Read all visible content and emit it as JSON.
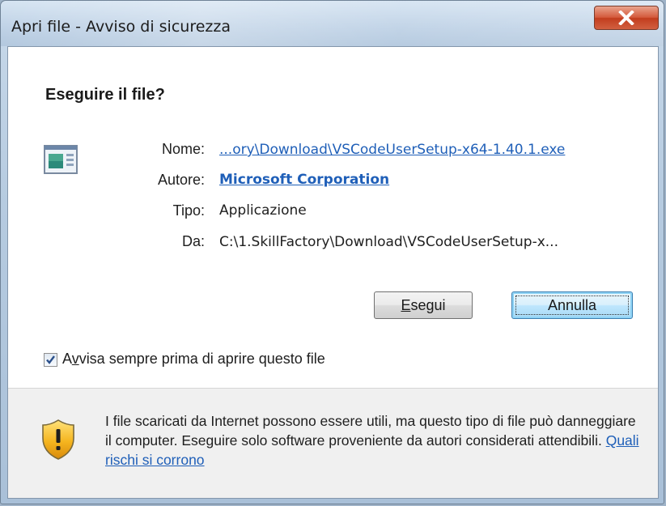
{
  "window": {
    "title": "Apri file - Avviso di sicurezza"
  },
  "dialog": {
    "heading": "Eseguire il file?",
    "fields": [
      {
        "label": "Nome:",
        "value": "...ory\\Download\\VSCodeUserSetup-x64-1.40.1.exe",
        "is_link": true
      },
      {
        "label": "Autore:",
        "value": "Microsoft Corporation",
        "is_link": true
      },
      {
        "label": "Tipo:",
        "value": "Applicazione",
        "is_link": false
      },
      {
        "label": "Da:",
        "value": "C:\\1.SkillFactory\\Download\\VSCodeUserSetup-x...",
        "is_link": false
      }
    ],
    "run_button": {
      "mnemonic": "E",
      "rest": "segui"
    },
    "cancel_button": {
      "label": "Annulla"
    },
    "checkbox": {
      "checked": true,
      "label_pre": "A",
      "label_mnemonic": "v",
      "label_post": "visa sempre prima di aprire questo file"
    }
  },
  "warning": {
    "text": "I file scaricati da Internet possono essere utili, ma questo tipo di file può danneggiare il computer. Eseguire solo software proveniente da autori considerati attendibili.",
    "link": "Quali rischi si corrono"
  },
  "colors": {
    "link": "#1f5fb8",
    "close_button": "#c9452a",
    "warning_panel": "#f0f0f0"
  },
  "icons": [
    "close-icon",
    "application-icon",
    "checkmark-icon",
    "security-shield-icon"
  ]
}
